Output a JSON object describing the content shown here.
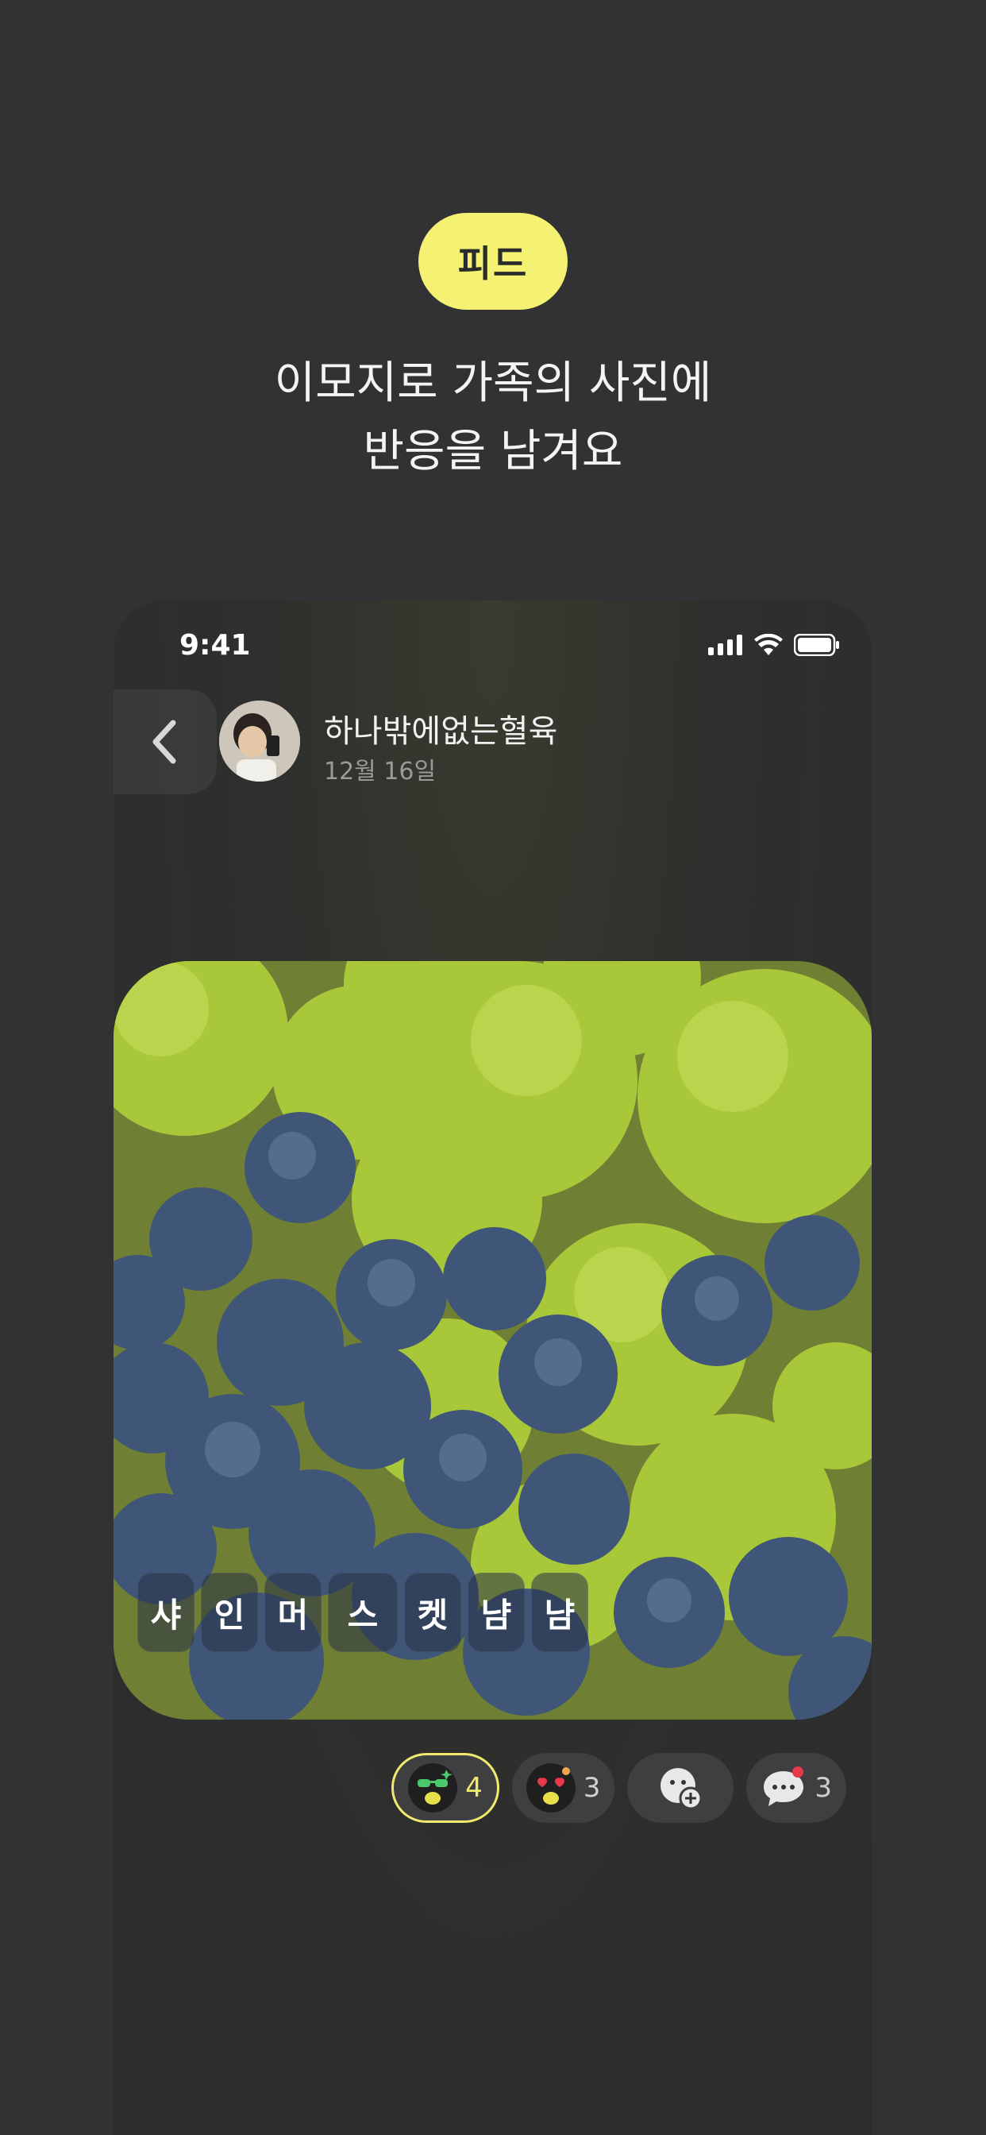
{
  "promo": {
    "badge": "피드",
    "headline_line1": "이모지로 가족의 사진에",
    "headline_line2": "반응을 남겨요"
  },
  "status_bar": {
    "time": "9:41"
  },
  "post": {
    "username": "하나밖에없는혈육",
    "date": "12월 16일",
    "caption_tiles": [
      "샤",
      "인",
      "머",
      "스",
      "켓",
      "냠",
      "냠"
    ]
  },
  "reactions": [
    {
      "icon": "sunglasses-emoji-icon",
      "count": "4",
      "selected": true
    },
    {
      "icon": "heart-eyes-emoji-icon",
      "count": "3",
      "selected": false
    },
    {
      "icon": "add-reaction-icon",
      "count": "",
      "selected": false
    },
    {
      "icon": "comment-icon",
      "count": "3",
      "selected": false
    }
  ],
  "colors": {
    "accent": "#f4f173",
    "background": "#323235"
  }
}
